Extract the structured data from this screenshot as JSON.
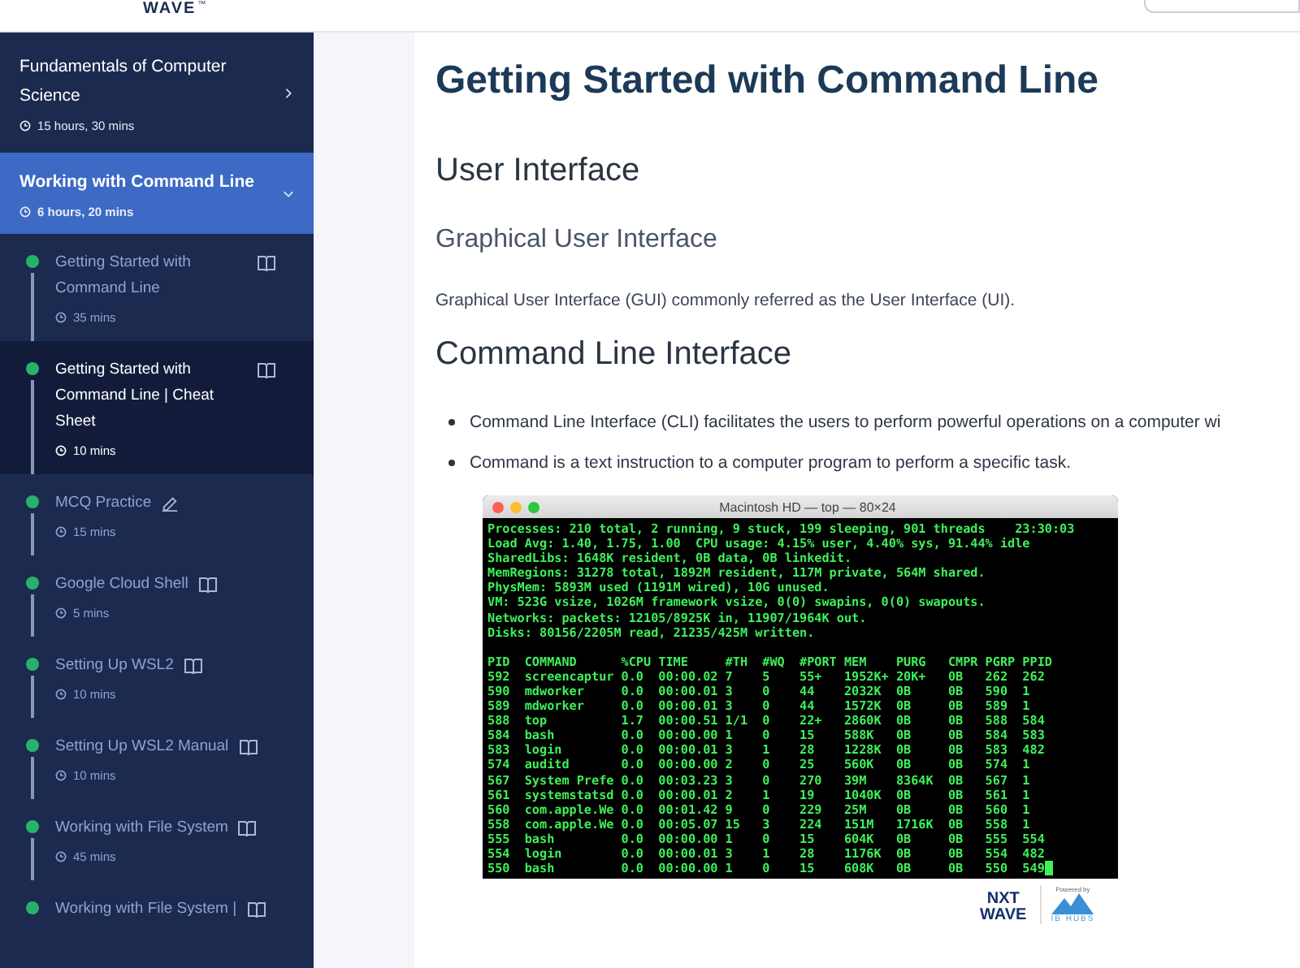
{
  "header": {
    "logo": "WAVE",
    "logo_mark": "™"
  },
  "sidebar": {
    "course": {
      "title": "Fundamentals of Computer Science",
      "duration": "15 hours, 30 mins",
      "expanded": false
    },
    "module": {
      "title": "Working with Command Line",
      "duration": "6 hours, 20 mins",
      "expanded": true
    },
    "lessons": [
      {
        "title": "Getting Started with Command Line",
        "duration": "35 mins",
        "kind": "reading",
        "completed": true,
        "selected": false
      },
      {
        "title": "Getting Started with Command Line | Cheat Sheet",
        "duration": "10 mins",
        "kind": "reading",
        "completed": true,
        "selected": true
      },
      {
        "title": "MCQ Practice",
        "duration": "15 mins",
        "kind": "practice",
        "completed": true,
        "selected": false
      },
      {
        "title": "Google Cloud Shell",
        "duration": "5 mins",
        "kind": "reading",
        "completed": true,
        "selected": false
      },
      {
        "title": "Setting Up WSL2",
        "duration": "10 mins",
        "kind": "reading",
        "completed": true,
        "selected": false
      },
      {
        "title": "Setting Up WSL2 Manual",
        "duration": "10 mins",
        "kind": "reading",
        "completed": true,
        "selected": false
      },
      {
        "title": "Working with File System",
        "duration": "45 mins",
        "kind": "reading",
        "completed": true,
        "selected": false
      },
      {
        "title": "Working with File System |",
        "kind": "reading",
        "completed": true,
        "selected": false
      }
    ]
  },
  "content": {
    "title": "Getting Started with Command Line",
    "section": "User Interface",
    "subsection": "Graphical User Interface",
    "paragraph": "Graphical User Interface (GUI) commonly referred as the User Interface (UI).",
    "section_2": "Command Line Interface",
    "bullets": [
      "Command Line Interface (CLI) facilitates the users to perform powerful operations on a computer wi",
      "Command is a text instruction to a computer program to perform a specific task."
    ],
    "terminal": {
      "title": "Macintosh HD — top — 80×24",
      "summary": [
        "Processes: 210 total, 2 running, 9 stuck, 199 sleeping, 901 threads    23:30:03",
        "Load Avg: 1.40, 1.75, 1.00  CPU usage: 4.15% user, 4.40% sys, 91.44% idle",
        "SharedLibs: 1648K resident, 0B data, 0B linkedit.",
        "MemRegions: 31278 total, 1892M resident, 117M private, 564M shared.",
        "PhysMem: 5893M used (1191M wired), 10G unused.",
        "VM: 523G vsize, 1026M framework vsize, 0(0) swapins, 0(0) swapouts.",
        "Networks: packets: 12105/8925K in, 11907/1964K out.",
        "Disks: 80156/2205M read, 21235/425M written."
      ],
      "table": [
        "PID  COMMAND      %CPU TIME     #TH  #WQ  #PORT MEM    PURG   CMPR PGRP PPID",
        "592  screencaptur 0.0  00:00.02 7    5    55+   1952K+ 20K+   0B   262  262",
        "590  mdworker     0.0  00:00.01 3    0    44    2032K  0B     0B   590  1",
        "589  mdworker     0.0  00:00.01 3    0    44    1572K  0B     0B   589  1",
        "588  top          1.7  00:00.51 1/1  0    22+   2860K  0B     0B   588  584",
        "584  bash         0.0  00:00.00 1    0    15    588K   0B     0B   584  583",
        "583  login        0.0  00:00.01 3    1    28    1228K  0B     0B   583  482",
        "574  auditd       0.0  00:00.00 2    0    25    560K   0B     0B   574  1",
        "567  System Prefe 0.0  00:03.23 3    0    270   39M    8364K  0B   567  1",
        "561  systemstatsd 0.0  00:00.01 2    1    19    1040K  0B     0B   561  1",
        "560  com.apple.We 0.0  00:01.42 9    0    229   25M    0B     0B   560  1",
        "558  com.apple.We 0.0  00:05.07 15   3    224   151M   1716K  0B   558  1",
        "555  bash         0.0  00:00.00 1    0    15    604K   0B     0B   555  554",
        "554  login        0.0  00:00.01 3    1    28    1176K  0B     0B   554  482",
        "550  bash         0.0  00:00.00 1    0    15    608K   0B     0B   550  549"
      ]
    },
    "footer_logo": {
      "brand_top": "NXT",
      "brand_bottom": "WAVE",
      "powered_by": "Powered by",
      "partner": "IB HUBS"
    }
  }
}
